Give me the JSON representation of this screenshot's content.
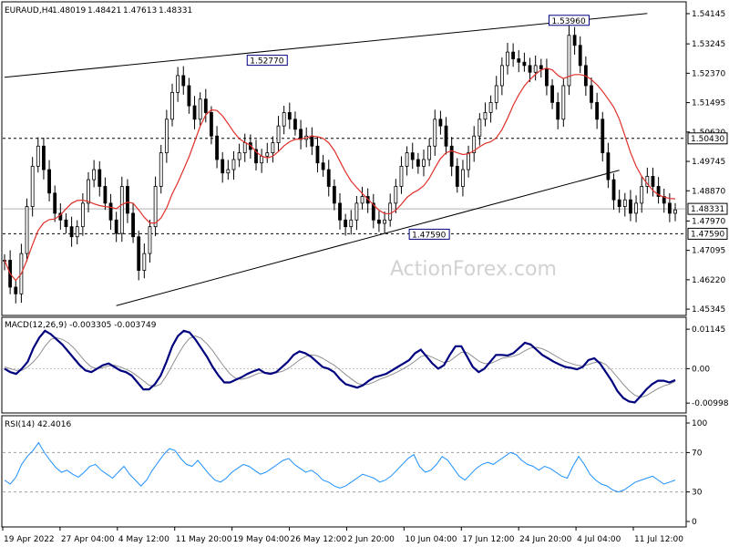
{
  "chart_data": [
    {
      "type": "candlestick",
      "title": "EURAUD,H4",
      "ohlc_header": [
        "1.48019",
        "1.48421",
        "1.47613",
        "1.48331"
      ],
      "watermark": "ActionForex.com",
      "x_labels": [
        "19 Apr 2022",
        "27 Apr 04:00",
        "4 May 12:00",
        "11 May 20:00",
        "19 May 04:00",
        "26 May 12:00",
        "2 Jun 20:00",
        "10 Jun 04:00",
        "17 Jun 12:00",
        "24 Jun 20:00",
        "4 Jul 04:00",
        "11 Jul 12:00"
      ],
      "y_ticks": [
        "1.54145",
        "1.53245",
        "1.52370",
        "1.51495",
        "1.50620",
        "1.49745",
        "1.48870",
        "1.47970",
        "1.47095",
        "1.46220",
        "1.45345"
      ],
      "ylim": [
        1.4532,
        1.5428
      ],
      "y_tick_values": [
        1.54145,
        1.53245,
        1.5237,
        1.51495,
        1.5062,
        1.49745,
        1.4887,
        1.4797,
        1.47095,
        1.4622,
        1.45345
      ],
      "price_labels": [
        {
          "text": "1.50430",
          "value": 1.5043,
          "style": "dashed-level"
        },
        {
          "text": "1.48331",
          "value": 1.48331,
          "style": "current"
        },
        {
          "text": "1.47590",
          "value": 1.4759,
          "style": "dashed-level"
        }
      ],
      "annotations": [
        {
          "text": "1.52770",
          "value": 1.5277
        },
        {
          "text": "1.47590",
          "value": 1.4759
        },
        {
          "text": "1.53960",
          "value": 1.5396
        }
      ],
      "trendlines": [
        {
          "from": [
            0,
            1.5225
          ],
          "to": [
            115,
            1.5415
          ]
        },
        {
          "from": [
            20,
            1.4545
          ],
          "to": [
            110,
            1.4948
          ]
        }
      ],
      "moving_average_color": "#e0302a",
      "candle_color": "#000000",
      "close": [
        1.468,
        1.46,
        1.458,
        1.47,
        1.484,
        1.496,
        1.502,
        1.495,
        1.488,
        1.482,
        1.48,
        1.478,
        1.475,
        1.478,
        1.485,
        1.492,
        1.495,
        1.49,
        1.485,
        1.48,
        1.476,
        1.49,
        1.482,
        1.475,
        1.465,
        1.47,
        1.478,
        1.49,
        1.5,
        1.51,
        1.518,
        1.523,
        1.52,
        1.514,
        1.51,
        1.516,
        1.512,
        1.505,
        1.498,
        1.494,
        1.495,
        1.498,
        1.5,
        1.503,
        1.501,
        1.497,
        1.499,
        1.5,
        1.503,
        1.508,
        1.512,
        1.51,
        1.507,
        1.504,
        1.505,
        1.502,
        1.497,
        1.495,
        1.49,
        1.485,
        1.48,
        1.478,
        1.48,
        1.485,
        1.487,
        1.485,
        1.48,
        1.479,
        1.48,
        1.485,
        1.49,
        1.496,
        1.5,
        1.498,
        1.496,
        1.498,
        1.502,
        1.51,
        1.508,
        1.502,
        1.496,
        1.49,
        1.495,
        1.5,
        1.505,
        1.51,
        1.512,
        1.515,
        1.52,
        1.526,
        1.53,
        1.528,
        1.527,
        1.526,
        1.524,
        1.526,
        1.525,
        1.52,
        1.515,
        1.51,
        1.52,
        1.535,
        1.532,
        1.526,
        1.52,
        1.515,
        1.51,
        1.5,
        1.492,
        1.486,
        1.484,
        1.486,
        1.482,
        1.485,
        1.49,
        1.493,
        1.49,
        1.487,
        1.485,
        1.482,
        1.483
      ]
    },
    {
      "type": "line",
      "title": "MACD(12,26,9) -0.003305 -0.003749",
      "y_ticks": [
        "0.01145",
        "0.00",
        "-0.009985"
      ],
      "ylim": [
        -0.0118,
        0.0128
      ],
      "y_tick_values": [
        0.01145,
        0.0,
        -0.009985
      ],
      "zero_line": 0.0,
      "series": [
        {
          "color": "#00007f",
          "values": [
            0.0,
            -0.001,
            -0.0015,
            0.0,
            0.002,
            0.006,
            0.009,
            0.011,
            0.01,
            0.0085,
            0.007,
            0.005,
            0.003,
            0.001,
            -0.0005,
            -0.001,
            0.0,
            0.001,
            0.0015,
            0.0005,
            -0.0005,
            -0.001,
            -0.002,
            -0.004,
            -0.006,
            -0.006,
            -0.0045,
            -0.002,
            0.002,
            0.0065,
            0.0095,
            0.011,
            0.0105,
            0.0085,
            0.006,
            0.0035,
            0.0005,
            -0.002,
            -0.004,
            -0.004,
            -0.0032,
            -0.0025,
            -0.0015,
            -0.0008,
            -0.0002,
            -0.0012,
            -0.0015,
            -0.001,
            0.0005,
            0.002,
            0.004,
            0.005,
            0.0045,
            0.0035,
            0.002,
            0.0005,
            0.0,
            -0.001,
            -0.003,
            -0.0045,
            -0.005,
            -0.0055,
            -0.0048,
            -0.0035,
            -0.0025,
            -0.002,
            -0.0015,
            -0.0005,
            0.0005,
            0.0015,
            0.0025,
            0.0045,
            0.0055,
            0.0035,
            0.0015,
            0.0,
            0.001,
            0.004,
            0.0065,
            0.0065,
            0.0035,
            0.0005,
            -0.001,
            0.0,
            0.002,
            0.004,
            0.004,
            0.0038,
            0.0045,
            0.006,
            0.0075,
            0.007,
            0.0055,
            0.004,
            0.003,
            0.002,
            0.0012,
            0.0005,
            0.0002,
            -0.0002,
            0.0005,
            0.0025,
            0.003,
            0.0015,
            -0.001,
            -0.0035,
            -0.0065,
            -0.0085,
            -0.0095,
            -0.0098,
            -0.008,
            -0.006,
            -0.0045,
            -0.0035,
            -0.0035,
            -0.004,
            -0.0033
          ]
        },
        {
          "color": "#909090",
          "values": [
            0.0005,
            0.0,
            -0.0005,
            -0.0005,
            0.0005,
            0.002,
            0.004,
            0.0065,
            0.0085,
            0.009,
            0.0085,
            0.0075,
            0.006,
            0.004,
            0.002,
            0.0005,
            0.0,
            0.0003,
            0.0008,
            0.001,
            0.0005,
            -0.0002,
            -0.001,
            -0.0022,
            -0.0035,
            -0.0048,
            -0.0052,
            -0.0045,
            -0.002,
            0.001,
            0.004,
            0.0068,
            0.0088,
            0.0095,
            0.0088,
            0.0072,
            0.0052,
            0.0028,
            0.0005,
            -0.0015,
            -0.0028,
            -0.0031,
            -0.0027,
            -0.002,
            -0.0013,
            -0.0011,
            -0.0012,
            -0.0012,
            -0.0008,
            0.0,
            0.0012,
            0.0025,
            0.0035,
            0.004,
            0.0038,
            0.003,
            0.002,
            0.001,
            -0.0003,
            -0.0017,
            -0.003,
            -0.0042,
            -0.0047,
            -0.0045,
            -0.0038,
            -0.003,
            -0.0024,
            -0.0017,
            -0.0009,
            0.0,
            0.001,
            0.0022,
            0.0035,
            0.004,
            0.0033,
            0.0025,
            0.0018,
            0.0022,
            0.0035,
            0.0047,
            0.0047,
            0.0035,
            0.0022,
            0.0015,
            0.0015,
            0.0022,
            0.003,
            0.0033,
            0.0036,
            0.0042,
            0.0052,
            0.006,
            0.0062,
            0.0058,
            0.005,
            0.004,
            0.003,
            0.0021,
            0.0015,
            0.001,
            0.0008,
            0.0012,
            0.0018,
            0.002,
            0.0012,
            -0.0005,
            -0.0025,
            -0.0045,
            -0.0063,
            -0.0077,
            -0.0083,
            -0.0078,
            -0.0068,
            -0.0058,
            -0.005,
            -0.0045,
            -0.0037
          ]
        }
      ]
    },
    {
      "type": "line",
      "title": "RSI(14) 42.4016",
      "y_ticks": [
        "100",
        "70",
        "30",
        "0"
      ],
      "ylim": [
        0,
        100
      ],
      "y_tick_values": [
        100,
        70,
        30,
        0
      ],
      "levels": [
        70,
        30
      ],
      "series": [
        {
          "color": "#1e90ff",
          "values": [
            42,
            38,
            45,
            58,
            66,
            72,
            80,
            70,
            62,
            55,
            50,
            52,
            48,
            45,
            50,
            56,
            58,
            52,
            48,
            44,
            50,
            56,
            48,
            42,
            36,
            42,
            52,
            60,
            68,
            74,
            72,
            64,
            58,
            56,
            62,
            55,
            48,
            42,
            40,
            44,
            50,
            54,
            58,
            56,
            52,
            48,
            50,
            54,
            58,
            62,
            64,
            58,
            54,
            50,
            52,
            48,
            42,
            40,
            36,
            34,
            36,
            40,
            44,
            48,
            46,
            44,
            40,
            42,
            46,
            52,
            58,
            64,
            68,
            56,
            50,
            52,
            58,
            66,
            62,
            54,
            46,
            42,
            48,
            54,
            58,
            60,
            58,
            62,
            66,
            70,
            68,
            62,
            58,
            56,
            52,
            56,
            54,
            50,
            46,
            44,
            56,
            66,
            58,
            48,
            42,
            38,
            36,
            32,
            30,
            32,
            36,
            40,
            42,
            44,
            46,
            42,
            38,
            40,
            42
          ]
        }
      ]
    }
  ]
}
